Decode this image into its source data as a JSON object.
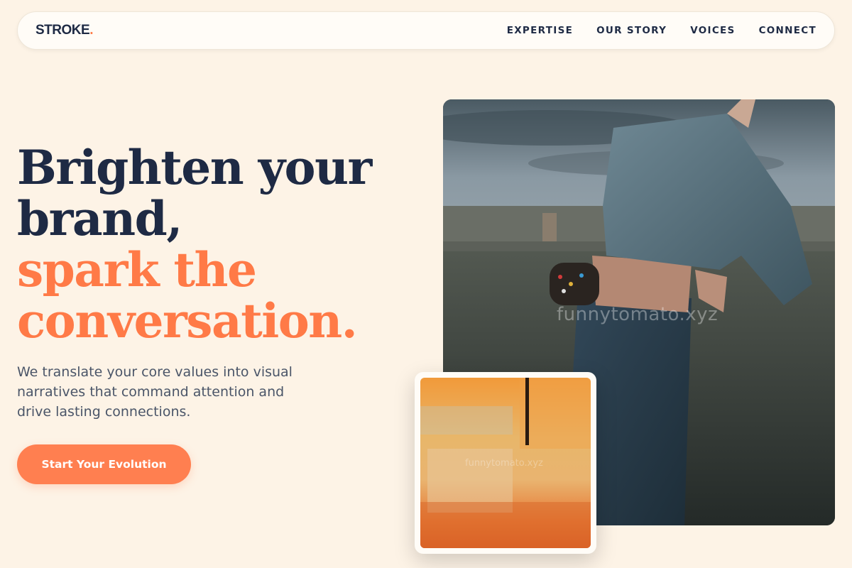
{
  "brand": {
    "name": "STROKE",
    "dot": "."
  },
  "nav": {
    "items": [
      {
        "label": "EXPERTISE"
      },
      {
        "label": "OUR STORY"
      },
      {
        "label": "VOICES"
      },
      {
        "label": "CONNECT"
      }
    ]
  },
  "hero": {
    "title_line1": "Brighten your",
    "title_line2": "brand,",
    "title_line3": "spark the",
    "title_line4": "conversation.",
    "subtitle": "We translate your core values into visual narratives that command attention and drive lasting connections.",
    "cta_label": "Start Your Evolution"
  },
  "images": {
    "main_watermark": "funnytomato.xyz",
    "card_watermark": "funnytomato.xyz",
    "main_icon": "person-photo",
    "card_icon": "abstract-painting"
  },
  "colors": {
    "background": "#fdf3e6",
    "dark": "#1e2a44",
    "accent": "#ff7a47",
    "text": "#4a5568"
  }
}
